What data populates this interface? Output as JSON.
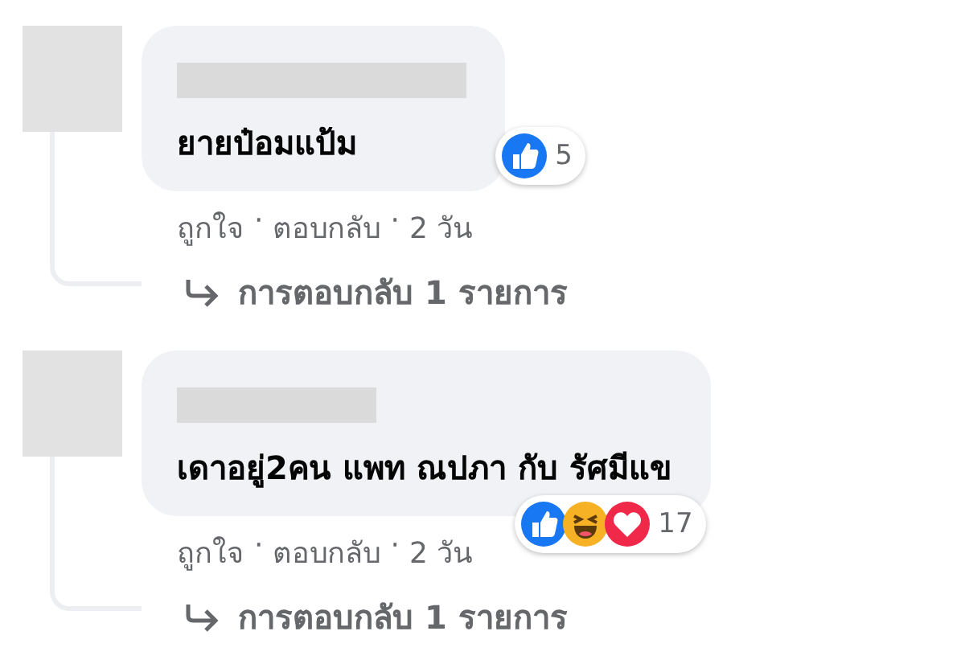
{
  "separator": "·",
  "comments": [
    {
      "text": "ยายป๋อมแป้ม",
      "reactions": [
        {
          "kind": "like"
        }
      ],
      "reaction_count": "5",
      "actions": [
        "ถูกใจ",
        "ตอบกลับ",
        "2 วัน"
      ],
      "replies_link": "การตอบกลับ 1 รายการ"
    },
    {
      "text": "เดาอยู่2คน แพท ณปภา กับ รัศมีแข",
      "reactions": [
        {
          "kind": "like"
        },
        {
          "kind": "haha"
        },
        {
          "kind": "love"
        }
      ],
      "reaction_count": "17",
      "actions": [
        "ถูกใจ",
        "ตอบกลับ",
        "2 วัน"
      ],
      "replies_link": "การตอบกลับ 1 รายการ"
    }
  ]
}
